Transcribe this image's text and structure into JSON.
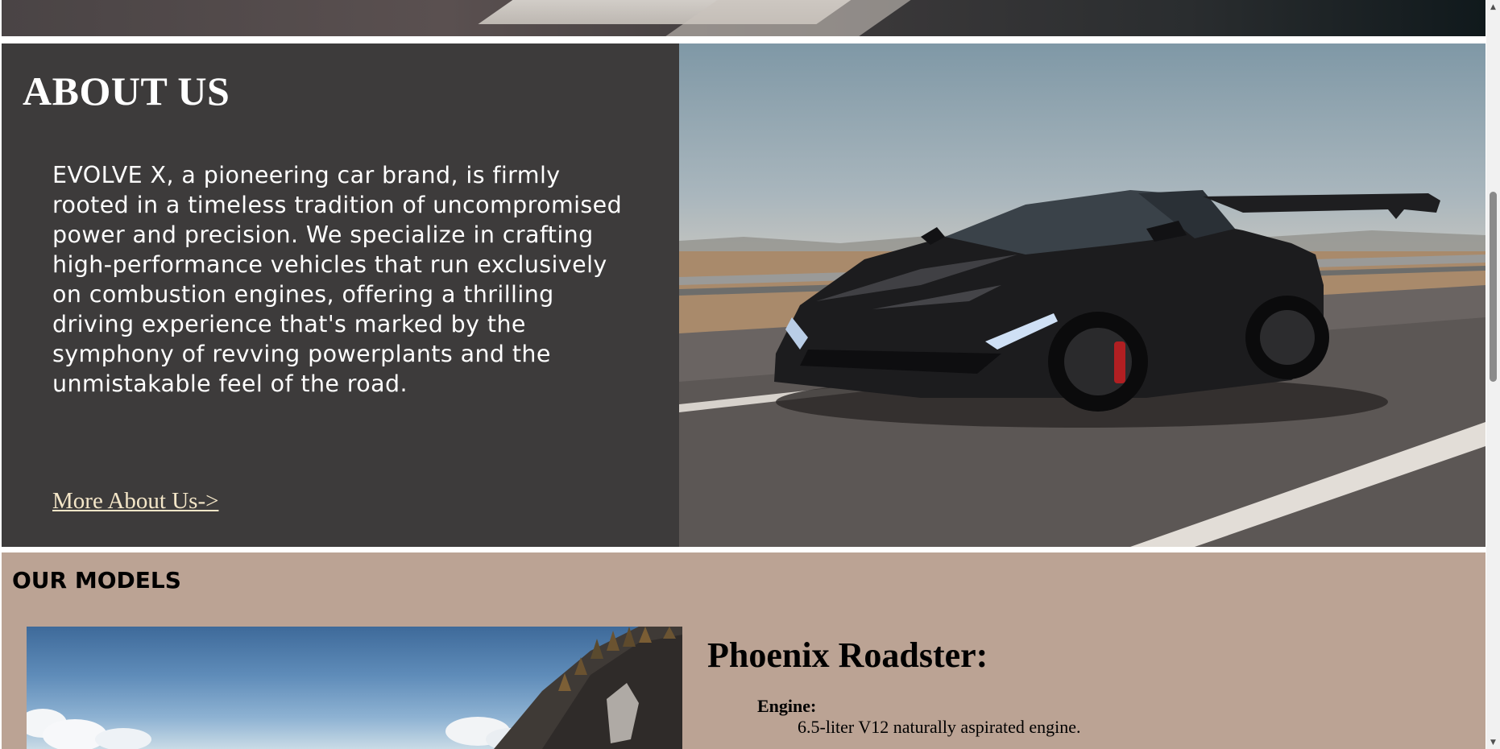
{
  "about": {
    "title": "ABOUT US",
    "body": "EVOLVE X, a pioneering car brand, is firmly rooted in a timeless tradition of uncompromised power and precision. We specialize in crafting high-performance vehicles that run exclusively on combustion engines, offering a thrilling driving experience that's marked by the symphony of revving powerplants and the unmistakable feel of the road.",
    "link_label": "More About Us->"
  },
  "models": {
    "title": "OUR MODELS",
    "featured": {
      "name": "Phoenix Roadster:",
      "spec_label": "Engine:",
      "spec_value": "6.5-liter V12 naturally aspirated engine."
    }
  },
  "colors": {
    "about_background": "#3d3b3b",
    "models_background": "#bba394",
    "link_color": "#f4e6c8"
  },
  "icons": {
    "scroll_up": "scroll-up-arrow-icon",
    "scroll_down": "scroll-down-arrow-icon"
  }
}
